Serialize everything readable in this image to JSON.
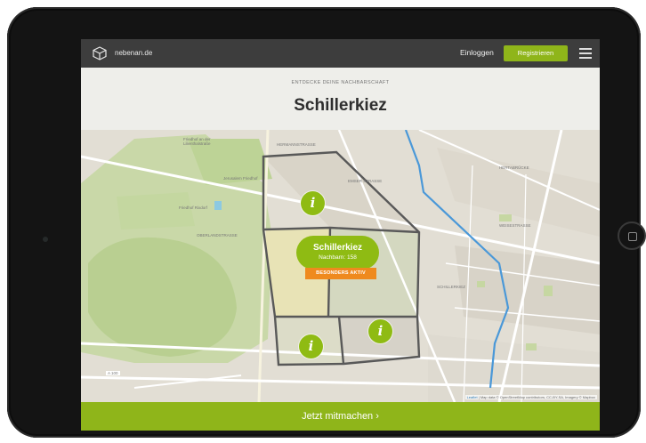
{
  "nav": {
    "brand": "nebenan.de",
    "login_label": "Einloggen",
    "register_label": "Registrieren",
    "logo_icon": "cube-logo-icon",
    "menu_icon": "hamburger-menu-icon"
  },
  "header": {
    "eyebrow": "ENTDECKE DEINE NACHBARSCHAFT",
    "title": "Schillerkiez"
  },
  "map": {
    "active_area": {
      "name": "Schillerkiez",
      "subtitle": "Nachbarn: 158",
      "badge": "BESONDERS AKTIV"
    },
    "info_marker_label": "i",
    "street_labels": [
      "HERMANNSTRASSE",
      "Friedhof an der Lilienthalstraße",
      "Jerusalem Friedhof",
      "Friedhof Rixdorf",
      "SCHILLERKIEZ",
      "WEISESTRASSE",
      "A 100",
      "OBERLANDSTRASSE",
      "EMSER STRASSE",
      "HERTABRÜCKE"
    ],
    "attribution": {
      "prefix": "Leaflet",
      "text": "| Map data © OpenStreetMap contributors, CC-BY-SA, Imagery © Mapbox"
    }
  },
  "cta": {
    "label": "Jetzt mitmachen ›"
  },
  "colors": {
    "accent_green": "#8fb51a",
    "badge_orange": "#ef8a1e",
    "nav_dark": "#3d3d3d"
  }
}
